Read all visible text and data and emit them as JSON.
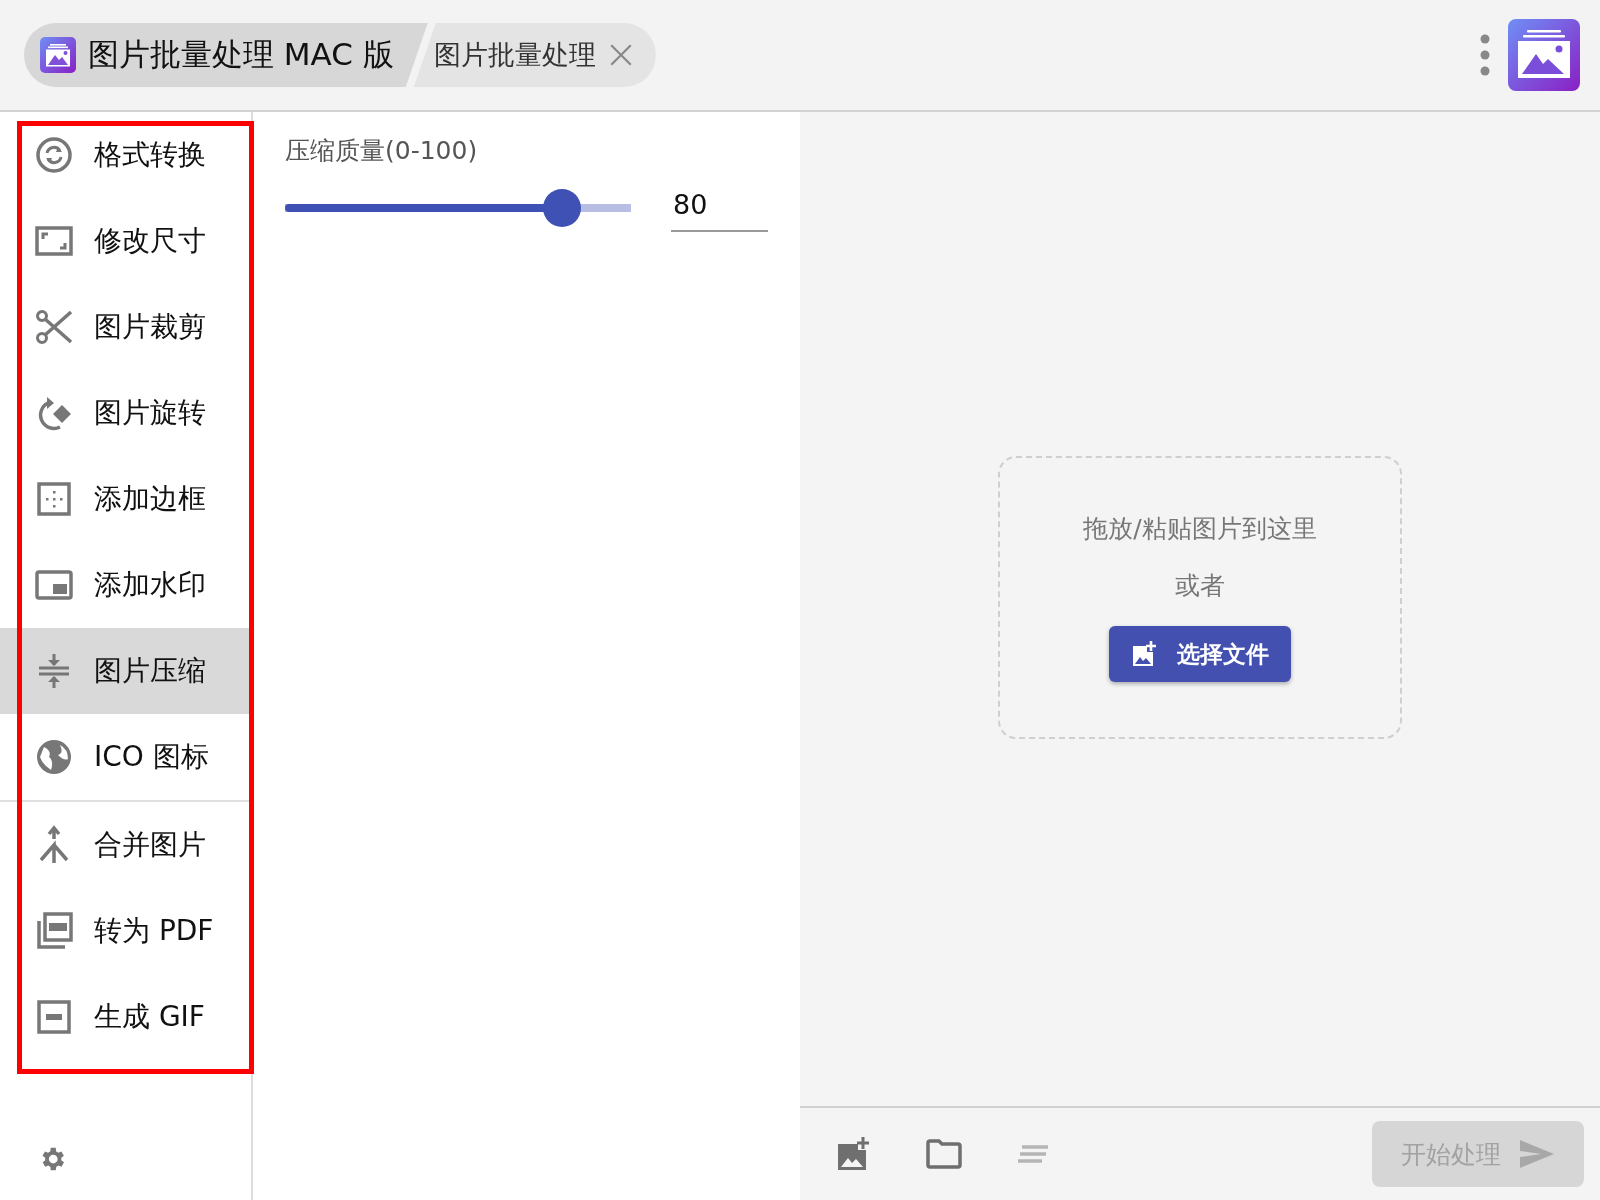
{
  "tabs": [
    {
      "label": "图片批量处理 MAC 版",
      "selected": true,
      "closable": false
    },
    {
      "label": "图片批量处理",
      "selected": false,
      "closable": true
    }
  ],
  "sidebar": {
    "highlighted": true,
    "groups": [
      {
        "items": [
          {
            "label": "格式转换",
            "selected": false
          },
          {
            "label": "修改尺寸",
            "selected": false
          },
          {
            "label": "图片裁剪",
            "selected": false
          },
          {
            "label": "图片旋转",
            "selected": false
          },
          {
            "label": "添加边框",
            "selected": false
          },
          {
            "label": "添加水印",
            "selected": false
          },
          {
            "label": "图片压缩",
            "selected": true
          },
          {
            "label": "ICO 图标",
            "selected": false
          }
        ]
      },
      {
        "items": [
          {
            "label": "合并图片",
            "selected": false
          },
          {
            "label": "转为 PDF",
            "selected": false
          },
          {
            "label": "生成 GIF",
            "selected": false
          }
        ]
      }
    ]
  },
  "compression": {
    "label": "压缩质量(0-100)",
    "level": 0.8,
    "value": "80"
  },
  "dropzone": {
    "hint": "拖放/粘贴图片到这里",
    "or": "或者",
    "button": "选择文件"
  },
  "start_button": {
    "label": "开始处理",
    "disabled": true
  }
}
